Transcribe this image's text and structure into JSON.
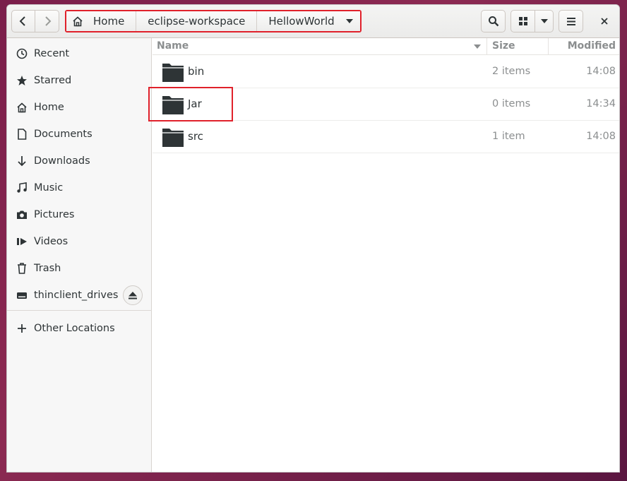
{
  "pathbar": {
    "crumbs": [
      "Home",
      "eclipse-workspace",
      "HellowWorld"
    ]
  },
  "toolbar": {
    "back": "back",
    "forward": "forward",
    "search": "search",
    "view": "grid-view",
    "menu": "menu",
    "close": "close"
  },
  "sidebar": {
    "items": [
      {
        "label": "Recent",
        "icon": "clock-icon"
      },
      {
        "label": "Starred",
        "icon": "star-icon"
      },
      {
        "label": "Home",
        "icon": "home-icon"
      },
      {
        "label": "Documents",
        "icon": "document-icon"
      },
      {
        "label": "Downloads",
        "icon": "download-icon"
      },
      {
        "label": "Music",
        "icon": "music-icon"
      },
      {
        "label": "Pictures",
        "icon": "camera-icon"
      },
      {
        "label": "Videos",
        "icon": "video-icon"
      },
      {
        "label": "Trash",
        "icon": "trash-icon"
      },
      {
        "label": "thinclient_drives",
        "icon": "drive-icon"
      }
    ],
    "other": {
      "label": "Other Locations",
      "icon": "plus-icon"
    }
  },
  "columns": {
    "name": "Name",
    "size": "Size",
    "modified": "Modified"
  },
  "files": [
    {
      "name": "bin",
      "size": "2 items",
      "modified": "14:08"
    },
    {
      "name": "Jar",
      "size": "0 items",
      "modified": "14:34"
    },
    {
      "name": "src",
      "size": "1 item",
      "modified": "14:08"
    }
  ],
  "colors": {
    "highlight": "#e0212b"
  }
}
